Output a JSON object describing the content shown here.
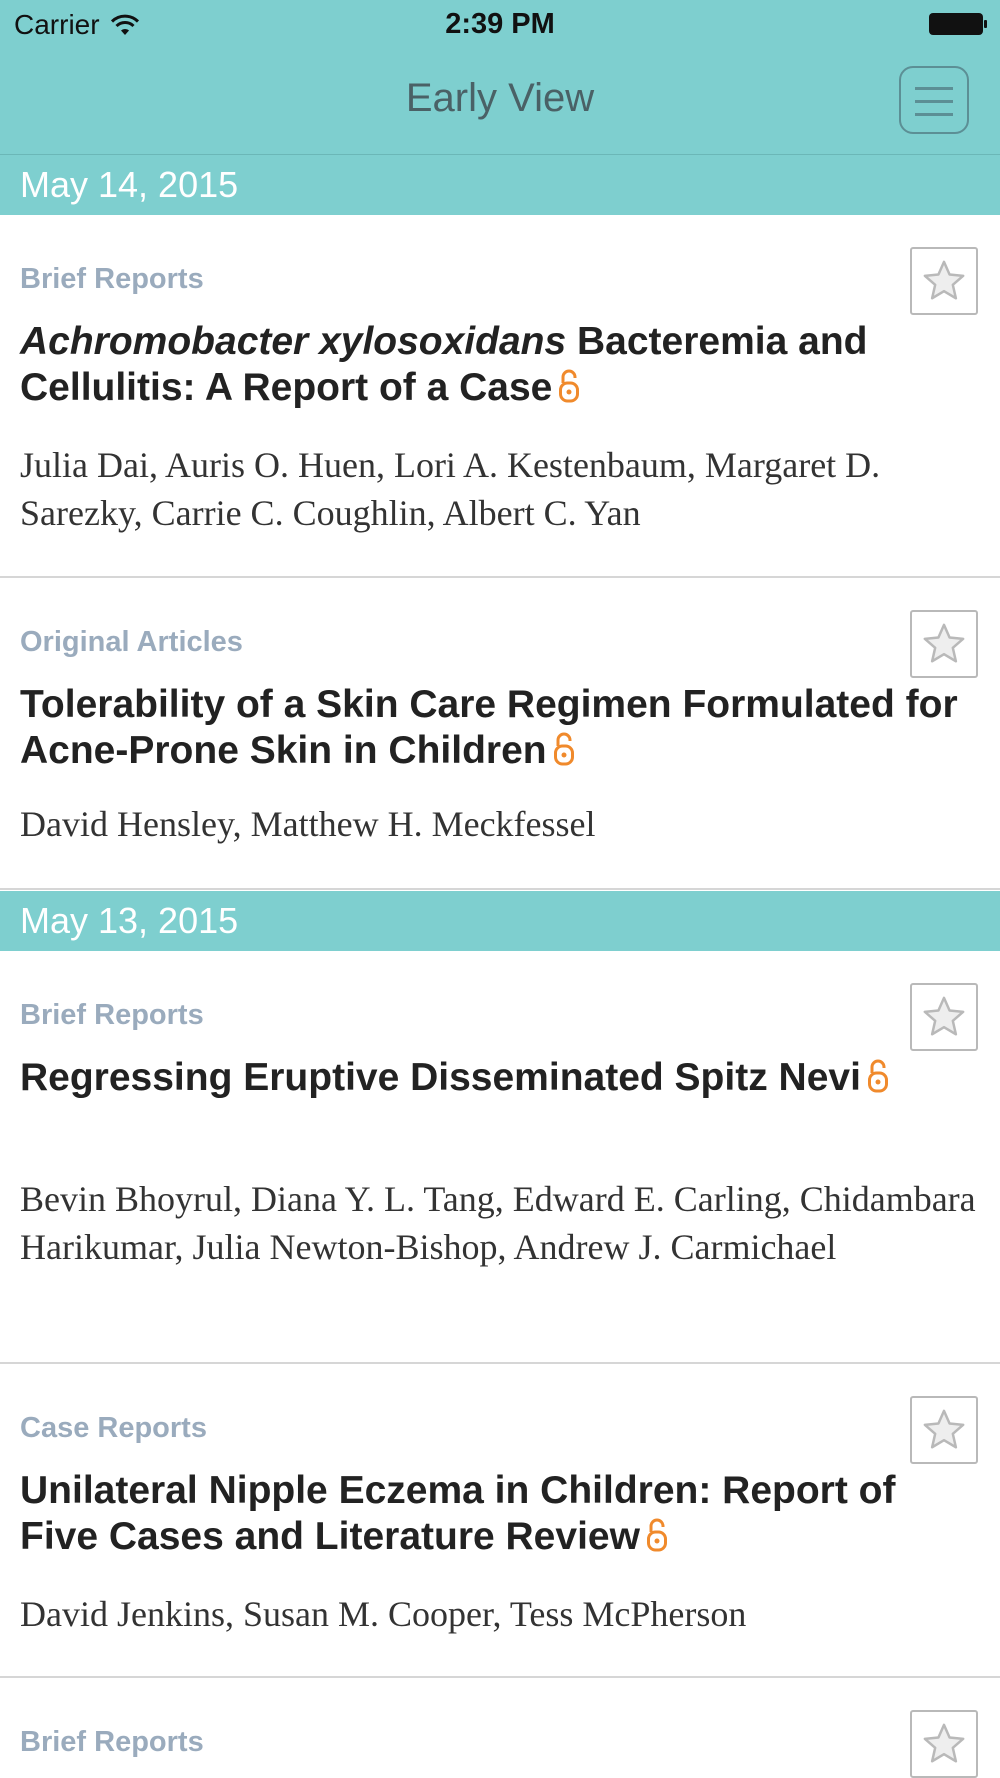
{
  "status_bar": {
    "carrier": "Carrier",
    "time": "2:39 PM"
  },
  "nav": {
    "title": "Early View",
    "menu_icon": "hamburger-menu-icon"
  },
  "colors": {
    "accent": "#7ecfcf",
    "category": "#9aabbd",
    "open_access": "#f08a2c"
  },
  "sections": [
    {
      "date": "May 14, 2015",
      "articles": [
        {
          "category": "Brief Reports",
          "title_italic": "Achromobacter xylosoxidans",
          "title": " Bacteremia and Cellulitis: A Report of a Case",
          "authors": "Julia Dai, Auris O. Huen, Lori A. Kestenbaum, Margaret D. Sarezky, Carrie C. Coughlin, Albert C. Yan",
          "open_access": true
        },
        {
          "category": "Original Articles",
          "title": "Tolerability of a Skin Care Regimen Formulated for Acne-Prone Skin in Children",
          "authors": "David Hensley, Matthew H. Meckfessel",
          "open_access": true
        }
      ]
    },
    {
      "date": "May 13, 2015",
      "articles": [
        {
          "category": "Brief Reports",
          "title": "Regressing Eruptive Disseminated Spitz Nevi",
          "authors": "Bevin Bhoyrul, Diana Y. L. Tang, Edward E. Carling, Chidambara Harikumar, Julia Newton-Bishop, Andrew J. Carmichael",
          "open_access": true
        },
        {
          "category": "Case Reports",
          "title": "Unilateral Nipple Eczema in Children: Report of Five Cases and Literature Review",
          "authors": "David Jenkins, Susan M. Cooper, Tess McPherson",
          "open_access": true
        },
        {
          "category": "Brief Reports"
        }
      ]
    }
  ]
}
